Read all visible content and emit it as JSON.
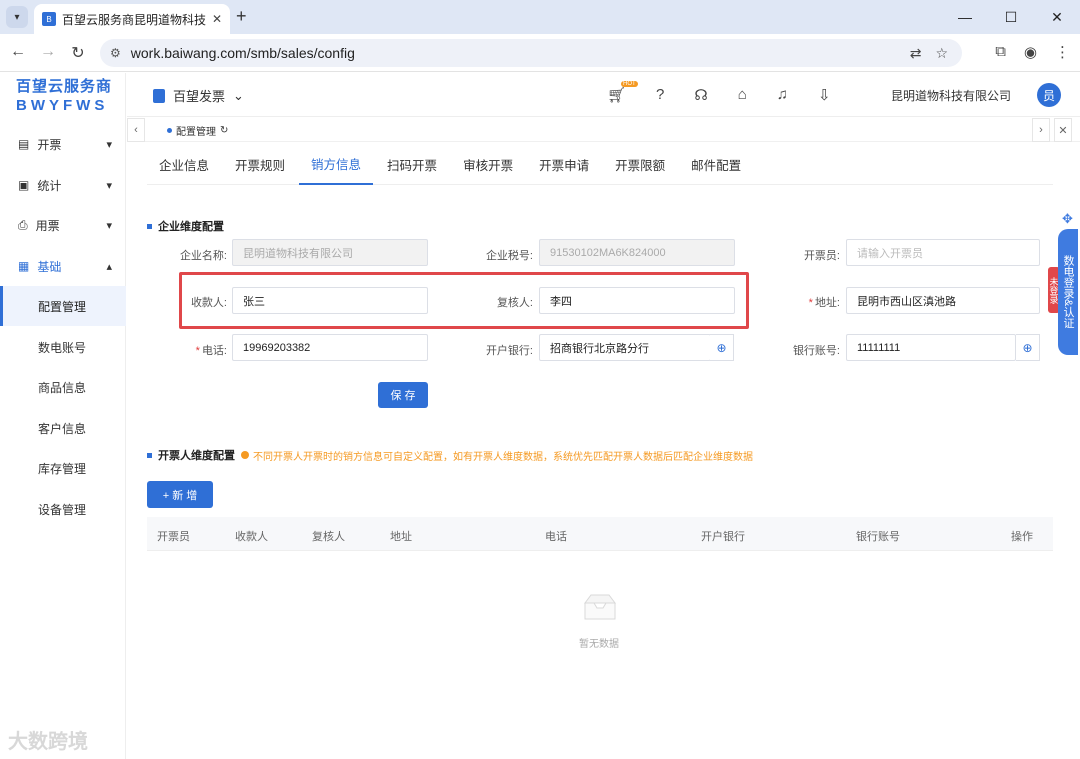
{
  "browser": {
    "tab_title": "百望云服务商昆明道物科技有限公司",
    "url": "work.baiwang.com/smb/sales/config",
    "new_tab": "+",
    "minimize": "—",
    "maximize": "☐",
    "close": "✕"
  },
  "brand": {
    "line1": "百望云服务商",
    "line2": "BWYFWS"
  },
  "sidebar": {
    "items": [
      {
        "label": "开票",
        "icon": "invoice-icon"
      },
      {
        "label": "统计",
        "icon": "chart-icon"
      },
      {
        "label": "用票",
        "icon": "printer-icon"
      },
      {
        "label": "基础",
        "icon": "base-icon"
      }
    ],
    "sub_items": [
      "配置管理",
      "数电账号",
      "商品信息",
      "客户信息",
      "库存管理",
      "设备管理"
    ],
    "active_sub": "配置管理"
  },
  "topbar": {
    "product": "百望发票",
    "hot_badge": "HOT",
    "company": "昆明道物科技有限公司",
    "avatar": "员"
  },
  "breadcrumb": {
    "tab": "配置管理"
  },
  "tabs": [
    "企业信息",
    "开票规则",
    "销方信息",
    "扫码开票",
    "审核开票",
    "开票申请",
    "开票限额",
    "邮件配置"
  ],
  "active_tab": "销方信息",
  "section1": {
    "title": "企业维度配置"
  },
  "form": {
    "company_name_label": "企业名称:",
    "company_name_value": "昆明道物科技有限公司",
    "tax_id_label": "企业税号:",
    "tax_id_value": "91530102MA6K824000",
    "issuer_label": "开票员:",
    "issuer_placeholder": "请输入开票员",
    "payee_label": "收款人:",
    "payee_value": "张三",
    "reviewer_label": "复核人:",
    "reviewer_value": "李四",
    "address_label": "地址:",
    "address_value": "昆明市西山区滇池路",
    "phone_label": "电话:",
    "phone_value": "19969203382",
    "bank_label": "开户银行:",
    "bank_value": "招商银行北京路分行",
    "account_label": "银行账号:",
    "account_value": "11111111",
    "save_label": "保 存"
  },
  "section2": {
    "title": "开票人维度配置",
    "hint": "不同开票人开票时的销方信息可自定义配置，如有开票人维度数据，系统优先匹配开票人数据后匹配企业维度数据",
    "add_label": "+ 新 增"
  },
  "table": {
    "headers": [
      "开票员",
      "收款人",
      "复核人",
      "地址",
      "电话",
      "开户银行",
      "银行账号",
      "操作"
    ],
    "empty_text": "暂无数据"
  },
  "float": {
    "tool_label": "数电登录&认证",
    "status_label": "未登录"
  },
  "watermark": "大数跨境",
  "colors": {
    "accent": "#2f6fd6",
    "highlight": "#e0474a",
    "hint": "#f59a23"
  }
}
